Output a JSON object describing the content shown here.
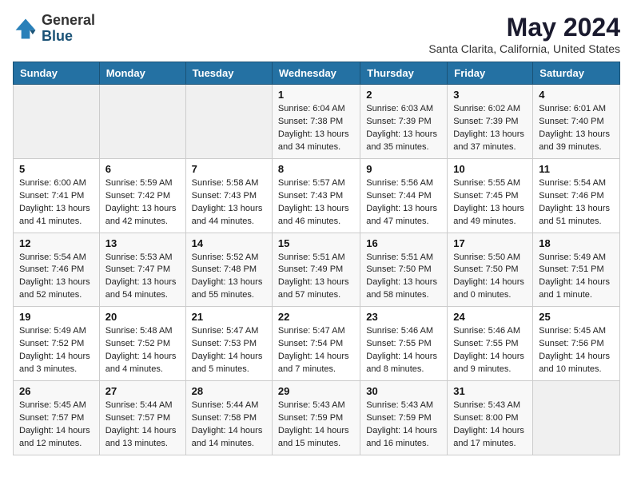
{
  "header": {
    "logo": {
      "line1": "General",
      "line2": "Blue"
    },
    "title": "May 2024",
    "location": "Santa Clarita, California, United States"
  },
  "days_of_week": [
    "Sunday",
    "Monday",
    "Tuesday",
    "Wednesday",
    "Thursday",
    "Friday",
    "Saturday"
  ],
  "weeks": [
    [
      {
        "day": "",
        "detail": ""
      },
      {
        "day": "",
        "detail": ""
      },
      {
        "day": "",
        "detail": ""
      },
      {
        "day": "1",
        "detail": "Sunrise: 6:04 AM\nSunset: 7:38 PM\nDaylight: 13 hours\nand 34 minutes."
      },
      {
        "day": "2",
        "detail": "Sunrise: 6:03 AM\nSunset: 7:39 PM\nDaylight: 13 hours\nand 35 minutes."
      },
      {
        "day": "3",
        "detail": "Sunrise: 6:02 AM\nSunset: 7:39 PM\nDaylight: 13 hours\nand 37 minutes."
      },
      {
        "day": "4",
        "detail": "Sunrise: 6:01 AM\nSunset: 7:40 PM\nDaylight: 13 hours\nand 39 minutes."
      }
    ],
    [
      {
        "day": "5",
        "detail": "Sunrise: 6:00 AM\nSunset: 7:41 PM\nDaylight: 13 hours\nand 41 minutes."
      },
      {
        "day": "6",
        "detail": "Sunrise: 5:59 AM\nSunset: 7:42 PM\nDaylight: 13 hours\nand 42 minutes."
      },
      {
        "day": "7",
        "detail": "Sunrise: 5:58 AM\nSunset: 7:43 PM\nDaylight: 13 hours\nand 44 minutes."
      },
      {
        "day": "8",
        "detail": "Sunrise: 5:57 AM\nSunset: 7:43 PM\nDaylight: 13 hours\nand 46 minutes."
      },
      {
        "day": "9",
        "detail": "Sunrise: 5:56 AM\nSunset: 7:44 PM\nDaylight: 13 hours\nand 47 minutes."
      },
      {
        "day": "10",
        "detail": "Sunrise: 5:55 AM\nSunset: 7:45 PM\nDaylight: 13 hours\nand 49 minutes."
      },
      {
        "day": "11",
        "detail": "Sunrise: 5:54 AM\nSunset: 7:46 PM\nDaylight: 13 hours\nand 51 minutes."
      }
    ],
    [
      {
        "day": "12",
        "detail": "Sunrise: 5:54 AM\nSunset: 7:46 PM\nDaylight: 13 hours\nand 52 minutes."
      },
      {
        "day": "13",
        "detail": "Sunrise: 5:53 AM\nSunset: 7:47 PM\nDaylight: 13 hours\nand 54 minutes."
      },
      {
        "day": "14",
        "detail": "Sunrise: 5:52 AM\nSunset: 7:48 PM\nDaylight: 13 hours\nand 55 minutes."
      },
      {
        "day": "15",
        "detail": "Sunrise: 5:51 AM\nSunset: 7:49 PM\nDaylight: 13 hours\nand 57 minutes."
      },
      {
        "day": "16",
        "detail": "Sunrise: 5:51 AM\nSunset: 7:50 PM\nDaylight: 13 hours\nand 58 minutes."
      },
      {
        "day": "17",
        "detail": "Sunrise: 5:50 AM\nSunset: 7:50 PM\nDaylight: 14 hours\nand 0 minutes."
      },
      {
        "day": "18",
        "detail": "Sunrise: 5:49 AM\nSunset: 7:51 PM\nDaylight: 14 hours\nand 1 minute."
      }
    ],
    [
      {
        "day": "19",
        "detail": "Sunrise: 5:49 AM\nSunset: 7:52 PM\nDaylight: 14 hours\nand 3 minutes."
      },
      {
        "day": "20",
        "detail": "Sunrise: 5:48 AM\nSunset: 7:52 PM\nDaylight: 14 hours\nand 4 minutes."
      },
      {
        "day": "21",
        "detail": "Sunrise: 5:47 AM\nSunset: 7:53 PM\nDaylight: 14 hours\nand 5 minutes."
      },
      {
        "day": "22",
        "detail": "Sunrise: 5:47 AM\nSunset: 7:54 PM\nDaylight: 14 hours\nand 7 minutes."
      },
      {
        "day": "23",
        "detail": "Sunrise: 5:46 AM\nSunset: 7:55 PM\nDaylight: 14 hours\nand 8 minutes."
      },
      {
        "day": "24",
        "detail": "Sunrise: 5:46 AM\nSunset: 7:55 PM\nDaylight: 14 hours\nand 9 minutes."
      },
      {
        "day": "25",
        "detail": "Sunrise: 5:45 AM\nSunset: 7:56 PM\nDaylight: 14 hours\nand 10 minutes."
      }
    ],
    [
      {
        "day": "26",
        "detail": "Sunrise: 5:45 AM\nSunset: 7:57 PM\nDaylight: 14 hours\nand 12 minutes."
      },
      {
        "day": "27",
        "detail": "Sunrise: 5:44 AM\nSunset: 7:57 PM\nDaylight: 14 hours\nand 13 minutes."
      },
      {
        "day": "28",
        "detail": "Sunrise: 5:44 AM\nSunset: 7:58 PM\nDaylight: 14 hours\nand 14 minutes."
      },
      {
        "day": "29",
        "detail": "Sunrise: 5:43 AM\nSunset: 7:59 PM\nDaylight: 14 hours\nand 15 minutes."
      },
      {
        "day": "30",
        "detail": "Sunrise: 5:43 AM\nSunset: 7:59 PM\nDaylight: 14 hours\nand 16 minutes."
      },
      {
        "day": "31",
        "detail": "Sunrise: 5:43 AM\nSunset: 8:00 PM\nDaylight: 14 hours\nand 17 minutes."
      },
      {
        "day": "",
        "detail": ""
      }
    ]
  ]
}
